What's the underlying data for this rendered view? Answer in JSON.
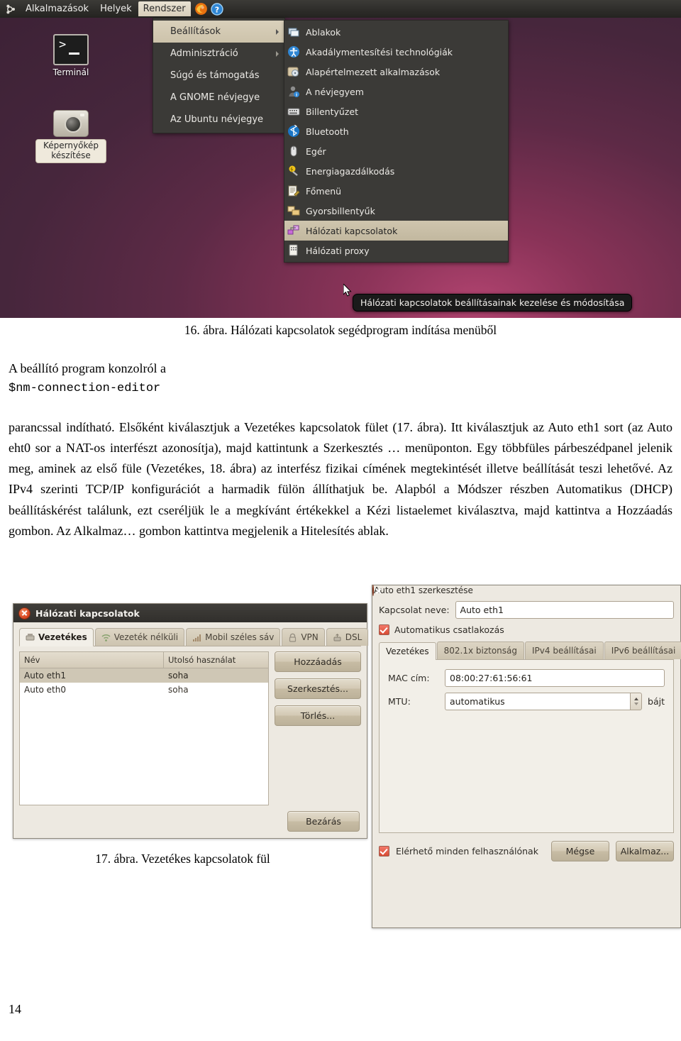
{
  "figure16": {
    "panel": {
      "apps": "Alkalmazások",
      "places": "Helyek",
      "system": "Rendszer",
      "firefox_icon": "firefox-icon",
      "help_icon": "help-icon",
      "ubuntu_icon": "ubuntu-logo-icon"
    },
    "desktop_icons": [
      {
        "label": "Terminál",
        "icon": "terminal-icon"
      },
      {
        "label": "Képernyőkép készítése",
        "icon": "camera-icon"
      }
    ],
    "menu_level1": [
      {
        "label": "Beállítások",
        "selected": true,
        "submenu": true
      },
      {
        "label": "Adminisztráció",
        "selected": false,
        "submenu": true
      },
      {
        "label": "Súgó és támogatás",
        "selected": false,
        "submenu": false
      },
      {
        "label": "A GNOME névjegye",
        "selected": false,
        "submenu": false
      },
      {
        "label": "Az Ubuntu névjegye",
        "selected": false,
        "submenu": false
      }
    ],
    "menu_level2": [
      {
        "label": "Ablakok",
        "icon": "windows-icon",
        "selected": false
      },
      {
        "label": "Akadálymentesítési technológiák",
        "icon": "accessibility-icon",
        "selected": false
      },
      {
        "label": "Alapértelmezett alkalmazások",
        "icon": "default-apps-icon",
        "selected": false
      },
      {
        "label": "A névjegyem",
        "icon": "user-info-icon",
        "selected": false
      },
      {
        "label": "Billentyűzet",
        "icon": "keyboard-icon",
        "selected": false
      },
      {
        "label": "Bluetooth",
        "icon": "bluetooth-icon",
        "selected": false
      },
      {
        "label": "Egér",
        "icon": "mouse-icon",
        "selected": false
      },
      {
        "label": "Energiagazdálkodás",
        "icon": "power-icon",
        "selected": false
      },
      {
        "label": "Főmenü",
        "icon": "main-menu-icon",
        "selected": false
      },
      {
        "label": "Gyorsbillentyűk",
        "icon": "shortcuts-icon",
        "selected": false
      },
      {
        "label": "Hálózati kapcsolatok",
        "icon": "network-connections-icon",
        "selected": true
      },
      {
        "label": "Hálózati proxy",
        "icon": "network-proxy-icon",
        "selected": false
      }
    ],
    "tooltip": "Hálózati kapcsolatok beállításainak kezelése és módosítása"
  },
  "caption16": "16. ábra. Hálózati kapcsolatok segédprogram indítása menüből",
  "caption17": "17. ábra. Vezetékes kapcsolatok fül",
  "paragraph1": {
    "line1": "A beállító program konzolról a",
    "command": "$nm-connection-editor"
  },
  "paragraph2": "parancssal indítható. Elsőként kiválasztjuk a Vezetékes kapcsolatok fület (17. ábra). Itt kiválasztjuk az Auto eth1 sort (az Auto eht0 sor a NAT-os interfészt azonosítja), majd kattintunk a Szerkesztés … menüponton. Egy többfüles párbeszédpanel jelenik meg, aminek az első füle (Vezetékes, 18. ábra) az interfész fizikai címének megtekintését illetve beállítását teszi lehetővé. Az IPv4 szerinti TCP/IP konfigurációt a harmadik fülön állíthatjuk be. Alapból a Módszer részben Automatikus (DHCP) beállításkérést találunk, ezt cseréljük le a megkívánt értékekkel a Kézi listaelemet kiválasztva, majd kattintva a Hozzáadás gombon. Az Alkalmaz… gombon kattintva megjelenik a Hitelesítés ablak.",
  "page_number": "14",
  "network_connections_window": {
    "title": "Hálózati kapcsolatok",
    "tabs": [
      {
        "label": "Vezetékes",
        "icon": "wired-icon",
        "active": true
      },
      {
        "label": "Vezeték nélküli",
        "icon": "wireless-icon",
        "active": false
      },
      {
        "label": "Mobil széles sáv",
        "icon": "mobile-broadband-icon",
        "active": false
      },
      {
        "label": "VPN",
        "icon": "vpn-lock-icon",
        "active": false
      },
      {
        "label": "DSL",
        "icon": "dsl-icon",
        "active": false
      }
    ],
    "columns": [
      "Név",
      "Utolsó használat"
    ],
    "rows": [
      {
        "name": "Auto eth1",
        "last_used": "soha",
        "selected": true
      },
      {
        "name": "Auto eth0",
        "last_used": "soha",
        "selected": false
      }
    ],
    "buttons": {
      "add": "Hozzáadás",
      "edit": "Szerkesztés...",
      "delete": "Törlés...",
      "close": "Bezárás"
    }
  },
  "edit_connection_window": {
    "title": "Auto eth1 szerkesztése",
    "connection_name_label": "Kapcsolat neve:",
    "connection_name_value": "Auto eth1",
    "autoconnect_label": "Automatikus csatlakozás",
    "autoconnect_checked": true,
    "tabs": [
      {
        "label": "Vezetékes",
        "active": true
      },
      {
        "label": "802.1x biztonság",
        "active": false
      },
      {
        "label": "IPv4 beállításai",
        "active": false
      },
      {
        "label": "IPv6 beállításai",
        "active": false
      }
    ],
    "fields": [
      {
        "label": "MAC cím:",
        "value": "08:00:27:61:56:61",
        "type": "text"
      },
      {
        "label": "MTU:",
        "value": "automatikus",
        "type": "spinner",
        "suffix": "bájt"
      }
    ],
    "available_all_users_label": "Elérhető minden felhasználónak",
    "available_all_users_checked": true,
    "buttons": {
      "cancel": "Mégse",
      "apply": "Alkalmaz..."
    }
  }
}
